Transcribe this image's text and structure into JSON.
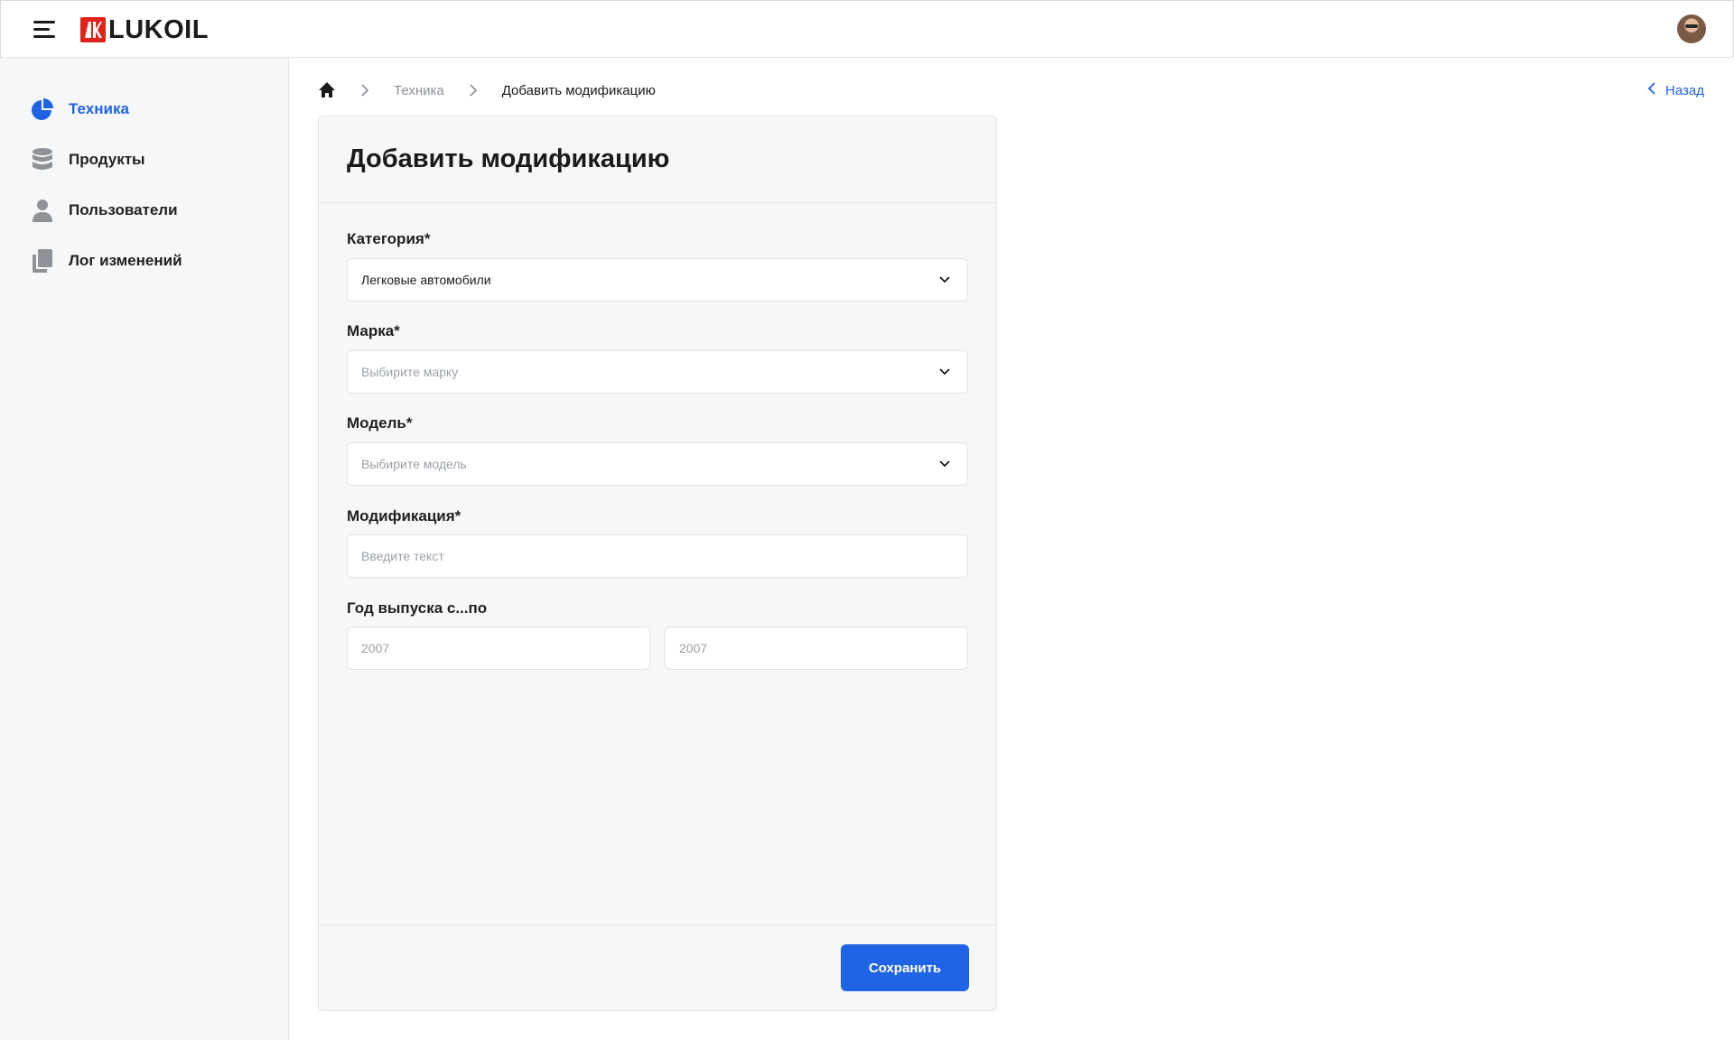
{
  "header": {
    "logo_text": "LUKOIL",
    "logo_mark": "ЛК",
    "menu_icon": "hamburger-icon",
    "avatar_icon": "user-avatar"
  },
  "sidebar": {
    "items": [
      {
        "label": "Техника",
        "icon": "pie-chart-icon",
        "active": true
      },
      {
        "label": "Продукты",
        "icon": "database-icon",
        "active": false
      },
      {
        "label": "Пользователи",
        "icon": "user-icon",
        "active": false
      },
      {
        "label": "Лог изменений",
        "icon": "documents-icon",
        "active": false
      }
    ]
  },
  "breadcrumb": {
    "items": [
      "Техника",
      "Добавить модификацию"
    ]
  },
  "back_label": "Назад",
  "form": {
    "title": "Добавить модификацию",
    "category": {
      "label": "Категория*",
      "value": "Легковые автомобили"
    },
    "brand": {
      "label": "Марка*",
      "placeholder": "Выбирите марку"
    },
    "model": {
      "label": "Модель*",
      "placeholder": "Выбирите модель"
    },
    "modification": {
      "label": "Модификация*",
      "placeholder": "Введите текст"
    },
    "years": {
      "label": "Год выпуска с...по",
      "from_placeholder": "2007",
      "to_placeholder": "2007"
    },
    "save_label": "Сохранить"
  },
  "colors": {
    "accent": "#1f63e6",
    "brand_red": "#e2231a",
    "sidebar_bg": "#f6f7f8"
  }
}
